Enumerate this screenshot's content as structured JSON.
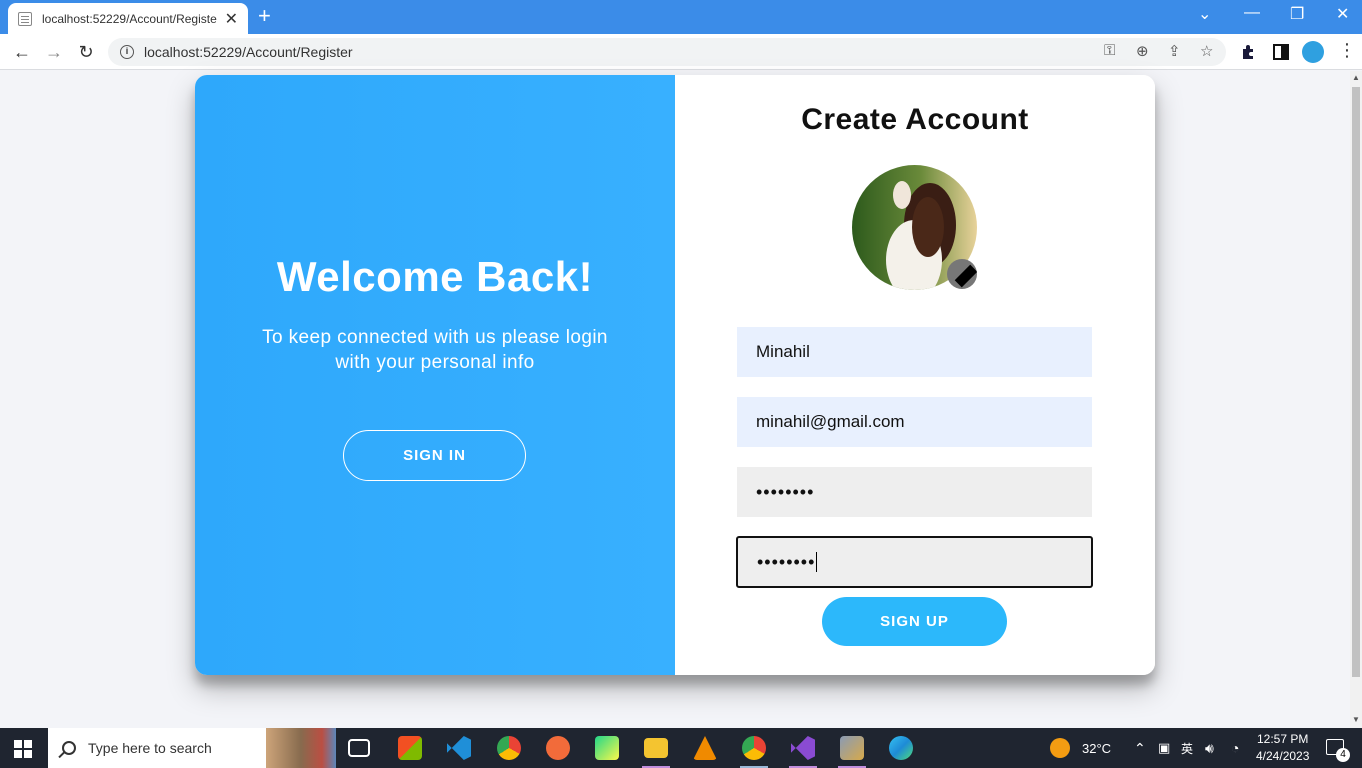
{
  "browser": {
    "tab_title": "localhost:52229/Account/Registe",
    "tab_close": "✕",
    "new_tab": "+",
    "url": "localhost:52229/Account/Register",
    "window_controls": {
      "tabs_menu": "⌄",
      "minimize": "—",
      "restore": "❐",
      "close": "✕"
    },
    "nav": {
      "back": "←",
      "forward": "→",
      "reload": "↻"
    },
    "url_icons": {
      "key": "⚿",
      "zoom": "⊕",
      "share": "⇪",
      "bookmark": "☆"
    },
    "menu": "⋮"
  },
  "left_panel": {
    "heading": "Welcome Back!",
    "text": "To keep connected with us please login with your personal info",
    "signin_label": "SIGN IN",
    "bg_color": "#33adff"
  },
  "right_panel": {
    "heading": "Create Account",
    "name_value": "Minahil",
    "email_value": "minahil@gmail.com",
    "password_value": "••••••••",
    "confirm_value": "••••••••",
    "signup_label": "SIGN UP",
    "button_color": "#2cb8fb"
  },
  "taskbar": {
    "search_placeholder": "Type here to search",
    "weather": "32°C",
    "time": "12:57 PM",
    "date": "4/24/2023",
    "notification_count": "4",
    "apps": [
      "task-view",
      "microsoft-store",
      "vscode",
      "chrome",
      "postman",
      "pycharm",
      "file-explorer",
      "vlc",
      "chrome-profile",
      "visual-studio",
      "tools",
      "edge"
    ]
  }
}
